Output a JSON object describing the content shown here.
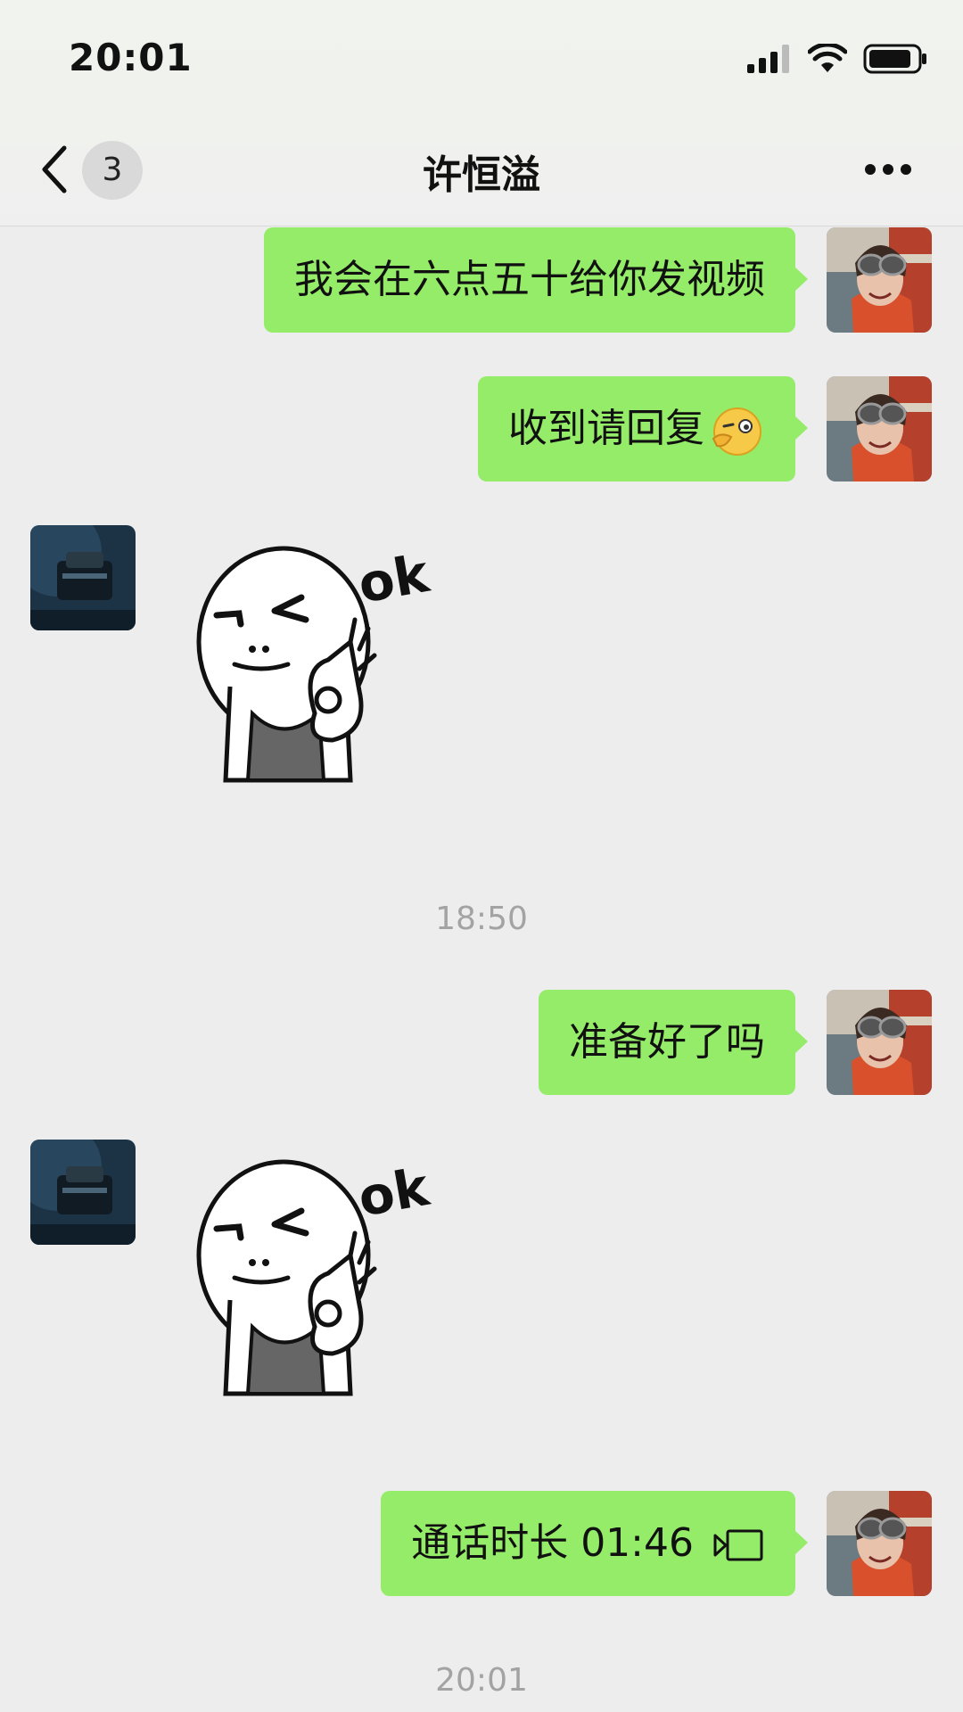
{
  "status_bar": {
    "time": "20:01"
  },
  "header": {
    "unread_count": "3",
    "title": "许恒溢"
  },
  "messages": [
    {
      "side": "self",
      "type": "text",
      "text": "我会在六点五十给你发视频"
    },
    {
      "side": "self",
      "type": "text",
      "text": "收到请回复"
    },
    {
      "side": "peer",
      "type": "sticker",
      "sticker_text": "ok"
    },
    {
      "side": "system",
      "type": "time",
      "text": "18:50"
    },
    {
      "side": "self",
      "type": "text",
      "text": "准备好了吗"
    },
    {
      "side": "peer",
      "type": "sticker",
      "sticker_text": "ok"
    },
    {
      "side": "self",
      "type": "call",
      "text": "通话时长 01:46",
      "icon": "video-call-icon"
    },
    {
      "side": "system",
      "type": "time",
      "text": "20:01"
    }
  ],
  "colors": {
    "bubble_self": "#95ec69",
    "chat_bg": "#ededed",
    "timestamp": "#a3a3a3"
  }
}
